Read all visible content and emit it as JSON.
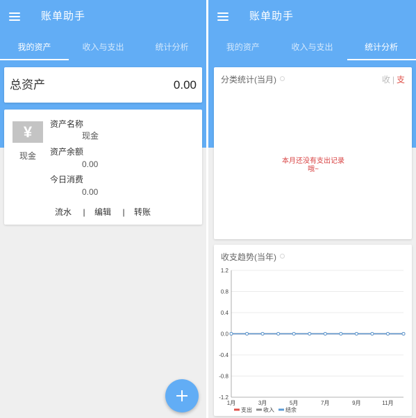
{
  "app": {
    "title": "账单助手",
    "brand_color": "#62adf5"
  },
  "left_screen": {
    "tabs": [
      {
        "label": "我的资产",
        "selected": true
      },
      {
        "label": "收入与支出",
        "selected": false
      },
      {
        "label": "统计分析",
        "selected": false
      }
    ],
    "total_assets": {
      "label": "总资产",
      "value": "0.00"
    },
    "asset_card": {
      "icon": "yen-icon",
      "icon_glyph": "¥",
      "type_label": "现金",
      "name_label": "资产名称",
      "name_value": "现金",
      "balance_label": "资产余额",
      "balance_value": "0.00",
      "today_label": "今日消费",
      "today_value": "0.00",
      "actions": [
        "流水",
        "编辑",
        "转账"
      ],
      "separator": "|"
    },
    "fab": {
      "icon": "plus-icon"
    }
  },
  "right_screen": {
    "tabs": [
      {
        "label": "我的资产",
        "selected": false
      },
      {
        "label": "收入与支出",
        "selected": false
      },
      {
        "label": "统计分析",
        "selected": true
      }
    ],
    "category_card": {
      "title": "分类统计(当月)",
      "toggle": {
        "income": "收",
        "separator": "|",
        "expense": "支",
        "income_active": false,
        "expense_active": true
      },
      "empty_message": "本月还没有支出记录哦~"
    }
  },
  "chart_data": {
    "type": "line",
    "title": "收支趋势(当年)",
    "x": [
      1,
      2,
      3,
      4,
      5,
      6,
      7,
      8,
      9,
      10,
      11,
      12
    ],
    "xlim": [
      1,
      12
    ],
    "x_ticks": [
      {
        "value": 1,
        "label": "1月"
      },
      {
        "value": 3,
        "label": "3月"
      },
      {
        "value": 5,
        "label": "5月"
      },
      {
        "value": 7,
        "label": "7月"
      },
      {
        "value": 9,
        "label": "9月"
      },
      {
        "value": 11,
        "label": "11月"
      }
    ],
    "ylim": [
      -1.2,
      1.2
    ],
    "y_ticks": [
      1.2,
      0.8,
      0.4,
      0,
      -0.4,
      -0.8,
      -1.2
    ],
    "y_tick_labels": [
      "1.2",
      "0.8",
      "0.4",
      "0.0",
      "-0.4",
      "-0.8",
      "-1.2"
    ],
    "grid": true,
    "legend": "bottom-left",
    "series": [
      {
        "name": "支出",
        "color": "#e0524a",
        "values": [
          0,
          0,
          0,
          0,
          0,
          0,
          0,
          0,
          0,
          0,
          0,
          0
        ]
      },
      {
        "name": "收入",
        "color": "#8c8c8c",
        "values": [
          0,
          0,
          0,
          0,
          0,
          0,
          0,
          0,
          0,
          0,
          0,
          0
        ]
      },
      {
        "name": "结余",
        "color": "#5b9bd5",
        "values": [
          0,
          0,
          0,
          0,
          0,
          0,
          0,
          0,
          0,
          0,
          0,
          0
        ]
      }
    ]
  }
}
